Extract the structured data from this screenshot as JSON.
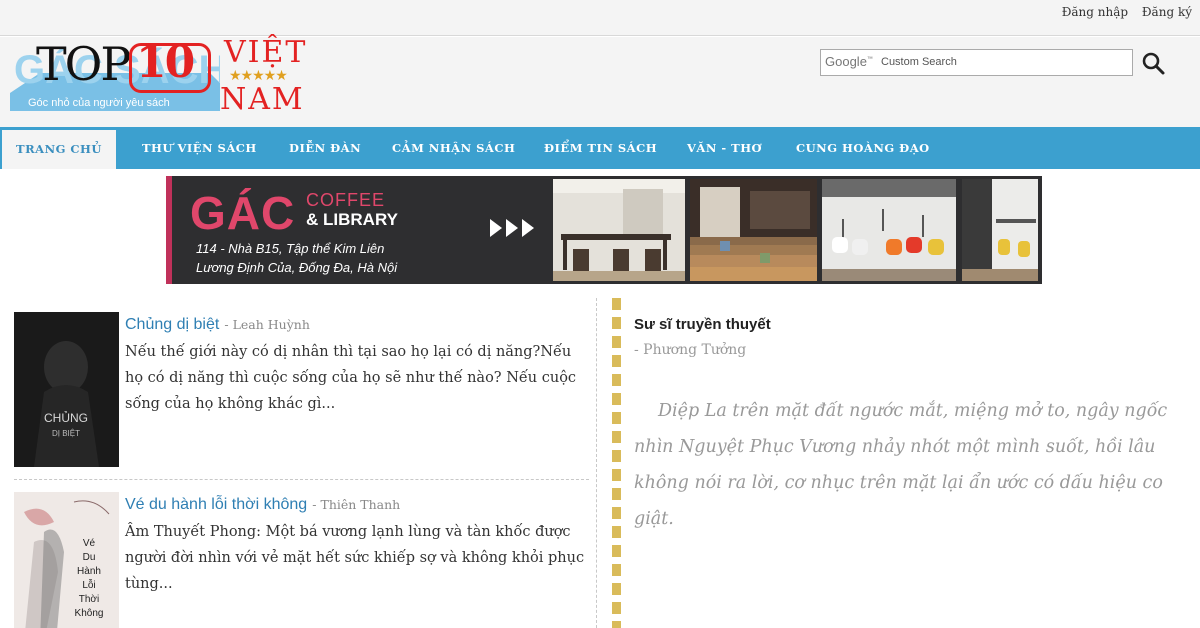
{
  "auth": {
    "login": "Đăng nhập",
    "register": "Đăng ký"
  },
  "site_logo": {
    "text": "GÁC SÁCH",
    "tagline": "Góc nhỏ của người yêu sách"
  },
  "overlay_logo": {
    "top": "TOP",
    "number": "10",
    "line1": "VIỆT",
    "stars": "★★★★★",
    "line2": "NAM"
  },
  "search": {
    "brand": "Google",
    "placeholder": "Custom Search"
  },
  "nav": {
    "items": [
      {
        "label": "TRANG CHỦ",
        "active": true
      },
      {
        "label": "THƯ VIỆN SÁCH"
      },
      {
        "label": "DIỄN ĐÀN"
      },
      {
        "label": "CẢM NHẬN SÁCH"
      },
      {
        "label": "ĐIỂM TIN SÁCH"
      },
      {
        "label": "VĂN - THƠ"
      },
      {
        "label": "CUNG HOÀNG ĐẠO"
      }
    ]
  },
  "banner": {
    "brand": "GÁC",
    "line1": "COFFEE",
    "line2": "& LIBRARY",
    "address1": "114 - Nhà B15, Tập thể Kim Liên",
    "address2": "Lương Định Của, Đống Đa, Hà Nội"
  },
  "books": [
    {
      "title": "Chủng dị biệt",
      "author": "- Leah Huỳnh",
      "cover_text": [
        "CHỦNG",
        "DỊ BIỆT"
      ],
      "description": "Nếu thế giới này có dị nhân thì tại sao họ lại có dị năng?Nếu họ có dị năng thì cuộc sống của họ sẽ như thế nào? Nếu cuộc sống của họ không khác gì..."
    },
    {
      "title": "Vé du hành lỗi thời không",
      "author": "- Thiên Thanh",
      "cover_text": [
        "Vé",
        "Du",
        "Hành",
        "Lỗi",
        "Thời",
        "Không"
      ],
      "description": "Âm Thuyết Phong: Một bá vương lạnh lùng và tàn khốc được người đời nhìn với vẻ mặt hết sức khiếp sợ và không khỏi phục tùng..."
    }
  ],
  "featured": {
    "title": "Sư sĩ truyền thuyết",
    "author": "- Phương Tưởng",
    "excerpt": "Diệp La trên mặt đất ngước mắt, miệng mở to, ngây ngốc nhìn Nguyệt Phục Vương nhảy nhót một mình suốt, hồi lâu không nói ra lời, cơ nhục trên mặt lại ẩn ước có dấu hiệu co giật."
  },
  "colors": {
    "nav_bg": "#3ca0cf",
    "link": "#2f7fb3",
    "banner_accent": "#e0476b",
    "logo_red": "#e32222"
  }
}
